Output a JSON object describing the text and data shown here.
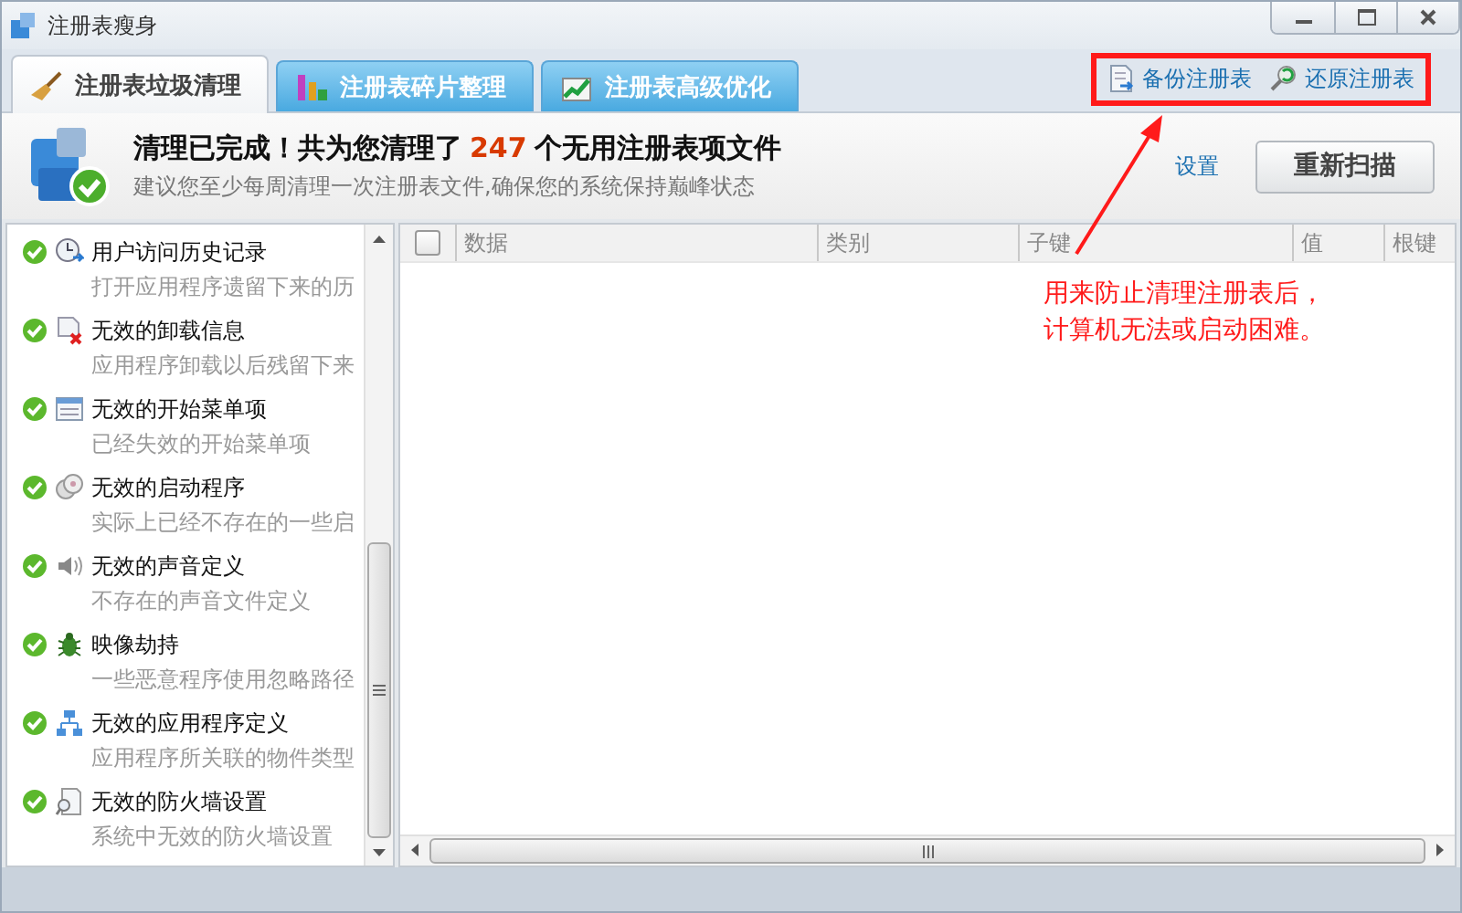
{
  "window": {
    "title": "注册表瘦身"
  },
  "tabs": [
    {
      "label": "注册表垃圾清理",
      "selected": true
    },
    {
      "label": "注册表碎片整理",
      "selected": false
    },
    {
      "label": "注册表高级优化",
      "selected": false
    }
  ],
  "top_links": [
    {
      "label": "备份注册表",
      "kind": "backup"
    },
    {
      "label": "还原注册表",
      "kind": "restore"
    }
  ],
  "summary": {
    "headline_before": "清理已完成！共为您清理了",
    "count": "247",
    "headline_after": "个无用注册表项文件",
    "hint": "建议您至少每周清理一次注册表文件,确保您的系统保持巅峰状态"
  },
  "settings_link": "设置",
  "rescan_button": "重新扫描",
  "categories": [
    {
      "title": "用户访问历史记录",
      "desc": "打开应用程序遗留下来的历",
      "done": true,
      "kind": "clock"
    },
    {
      "title": "无效的卸载信息",
      "desc": "应用程序卸载以后残留下来",
      "done": true,
      "kind": "uninstall"
    },
    {
      "title": "无效的开始菜单项",
      "desc": "已经失效的开始菜单项",
      "done": true,
      "kind": "menu"
    },
    {
      "title": "无效的启动程序",
      "desc": "实际上已经不存在的一些启",
      "done": true,
      "kind": "disc"
    },
    {
      "title": "无效的声音定义",
      "desc": "不存在的声音文件定义",
      "done": true,
      "kind": "speaker"
    },
    {
      "title": "映像劫持",
      "desc": "一些恶意程序使用忽略路径",
      "done": true,
      "kind": "bug"
    },
    {
      "title": "无效的应用程序定义",
      "desc": "应用程序所关联的物件类型",
      "done": true,
      "kind": "network"
    },
    {
      "title": "无效的防火墙设置",
      "desc": "系统中无效的防火墙设置",
      "done": true,
      "kind": "doc"
    }
  ],
  "table": {
    "select_all": false,
    "columns": [
      "数据",
      "类别",
      "子键",
      "值",
      "根键"
    ]
  },
  "annotation": {
    "lines": [
      "用来防止清理注册表后，",
      "计算机无法或启动困难。"
    ]
  }
}
